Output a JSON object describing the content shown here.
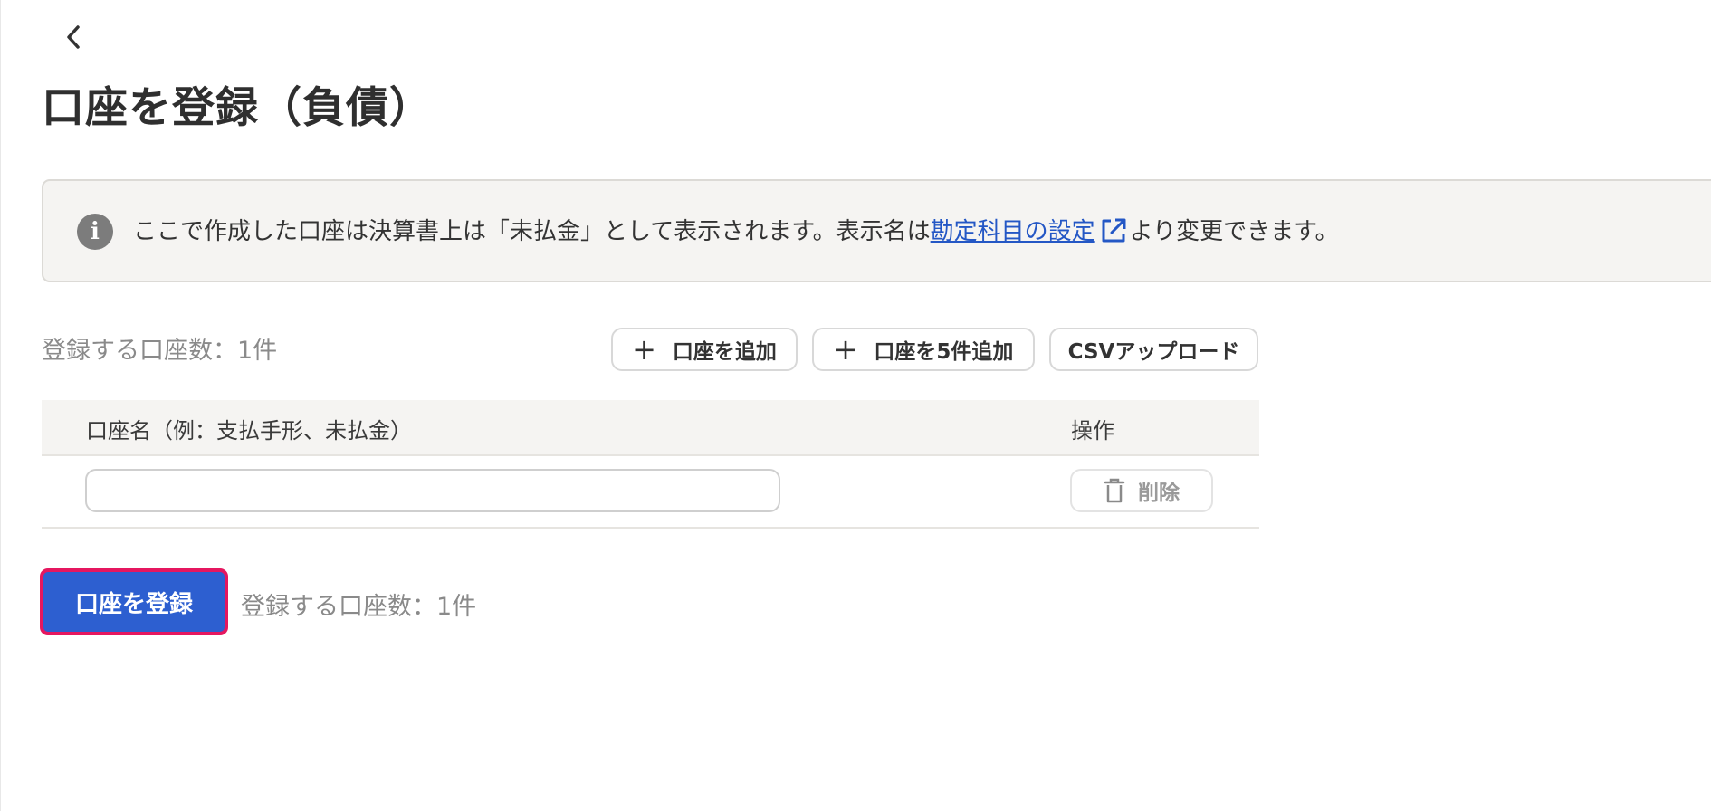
{
  "header": {
    "back_icon": "chevron-left-icon",
    "title": "口座を登録（負債）"
  },
  "notice": {
    "icon": "info-icon",
    "icon_glyph": "i",
    "text_before": "ここで作成した口座は決算書上は「未払金」として表示されます。表示名は",
    "link_text": "勘定科目の設定",
    "link_icon": "external-link-icon",
    "text_after": "より変更できます。"
  },
  "toolbar": {
    "count_label": "登録する口座数：1件",
    "add_label": "口座を追加",
    "add5_label": "口座を5件追加",
    "csv_label": "CSVアップロード",
    "plus_glyph": "+"
  },
  "table": {
    "columns": [
      "口座名（例：支払手形、未払金）",
      "操作"
    ],
    "rows": [
      {
        "name_value": "",
        "delete_label": "削除",
        "delete_icon": "trash-icon"
      }
    ]
  },
  "footer": {
    "register_label": "口座を登録",
    "count_label": "登録する口座数：1件"
  },
  "colors": {
    "primary": "#2d5fd0",
    "focus_ring": "#e5175f",
    "link": "#2457c5",
    "notice_bg": "#f5f4f2"
  }
}
